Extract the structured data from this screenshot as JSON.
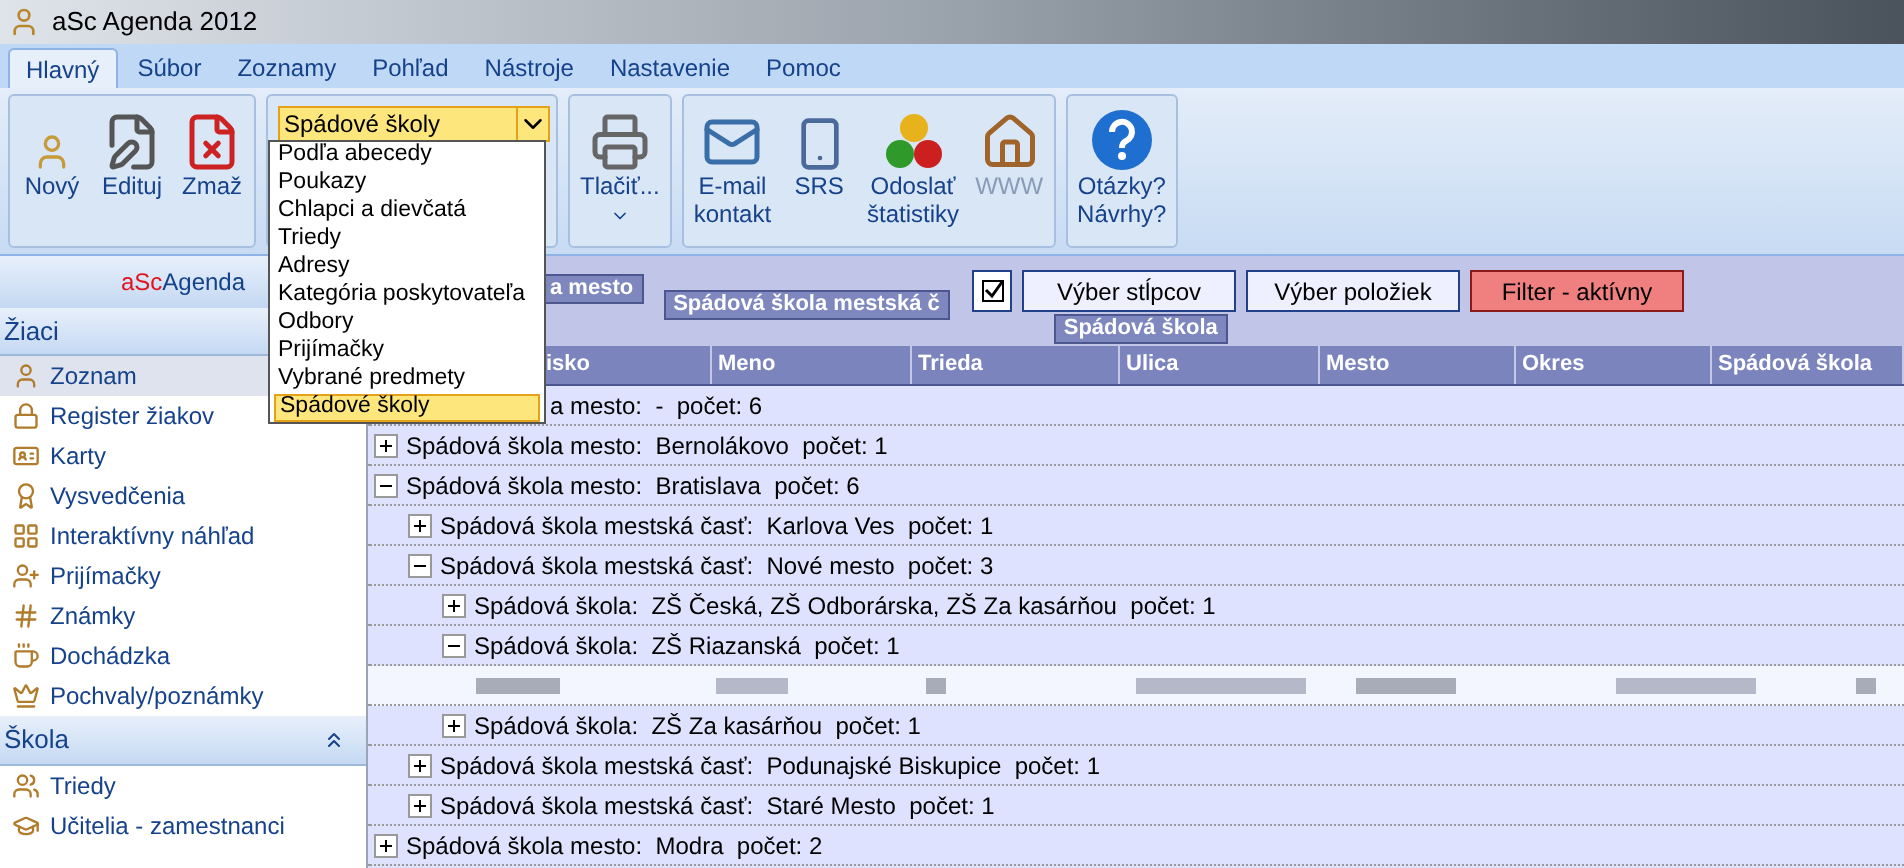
{
  "window": {
    "title": "aSc Agenda 2012"
  },
  "tabs": [
    {
      "label": "Hlavný",
      "selected": true
    },
    {
      "label": "Súbor",
      "selected": false
    },
    {
      "label": "Zoznamy",
      "selected": false
    },
    {
      "label": "Pohľad",
      "selected": false
    },
    {
      "label": "Nástroje",
      "selected": false
    },
    {
      "label": "Nastavenie",
      "selected": false
    },
    {
      "label": "Pomoc",
      "selected": false
    }
  ],
  "ribbon": {
    "groups": [
      {
        "kind": "buttons",
        "buttons": [
          {
            "lines": [
              "Nový"
            ],
            "disabled": false,
            "menu": false
          },
          {
            "lines": [
              "Edituj"
            ],
            "disabled": false,
            "menu": false
          },
          {
            "lines": [
              "Zmaž"
            ],
            "disabled": false,
            "menu": false
          }
        ]
      },
      {
        "kind": "combo",
        "value": "Spádové školy",
        "expanded": true,
        "options": [
          {
            "label": "Podľa abecedy",
            "selected": false
          },
          {
            "label": "Poukazy",
            "selected": false
          },
          {
            "label": "Chlapci a dievčatá",
            "selected": false
          },
          {
            "label": "Triedy",
            "selected": false
          },
          {
            "label": "Adresy",
            "selected": false
          },
          {
            "label": "Kategória poskytovateľa",
            "selected": false
          },
          {
            "label": "Odbory",
            "selected": false
          },
          {
            "label": "Prijímačky",
            "selected": false
          },
          {
            "label": "Vybrané predmety",
            "selected": false
          },
          {
            "label": "Spádové školy",
            "selected": true
          }
        ]
      },
      {
        "kind": "buttons",
        "buttons": [
          {
            "lines": [
              "Tlačiť..."
            ],
            "disabled": false,
            "menu": true
          }
        ]
      },
      {
        "kind": "buttons",
        "buttons": [
          {
            "lines": [
              "E-mail",
              "kontakt"
            ],
            "disabled": false,
            "menu": false
          },
          {
            "lines": [
              "SRS"
            ],
            "disabled": false,
            "menu": false
          },
          {
            "lines": [
              "Odoslať",
              "štatistiky"
            ],
            "disabled": false,
            "menu": false
          },
          {
            "lines": [
              "WWW"
            ],
            "disabled": true,
            "menu": false
          }
        ]
      },
      {
        "kind": "buttons",
        "buttons": [
          {
            "lines": [
              "Otázky?",
              "Návrhy?"
            ],
            "disabled": false,
            "menu": false
          }
        ]
      }
    ]
  },
  "sidebar": {
    "brand_prefix": "aSc",
    "brand_suffix": "Agenda",
    "sections": [
      {
        "title": "Žiaci",
        "collapsible": false,
        "items": [
          {
            "label": "Zoznam",
            "selected": true
          },
          {
            "label": "Register žiakov",
            "selected": false
          },
          {
            "label": "Karty",
            "selected": false
          },
          {
            "label": "Vysvedčenia",
            "selected": false
          },
          {
            "label": "Interaktívny náhľad",
            "selected": false
          },
          {
            "label": "Prijímačky",
            "selected": false
          },
          {
            "label": "Známky",
            "selected": false
          },
          {
            "label": "Dochádzka",
            "selected": false
          },
          {
            "label": "Pochvaly/poznámky",
            "selected": false
          }
        ]
      },
      {
        "title": "Škola",
        "collapsible": true,
        "items": [
          {
            "label": "Triedy",
            "selected": false
          },
          {
            "label": "Učitelia - zamestnanci",
            "selected": false
          }
        ]
      }
    ]
  },
  "group_panel": {
    "groups": [
      "a mesto",
      "Spádová škola mestská č",
      "Spádová škola"
    ],
    "checkbox_checked": true,
    "buttons": [
      {
        "label": "Výber stĺpcov",
        "active": false
      },
      {
        "label": "Výber položiek",
        "active": false
      },
      {
        "label": "Filter - aktívny",
        "active": true
      }
    ]
  },
  "table": {
    "columns": [
      "isko",
      "Meno",
      "Trieda",
      "Ulica",
      "Mesto",
      "Okres",
      "Spádová škola"
    ],
    "covered_row": "a mesto:  -  počet: 6",
    "rows": [
      {
        "kind": "group",
        "label": "Spádová škola mesto:  Bernolákovo  počet: 1",
        "expanded": false
      },
      {
        "kind": "group",
        "label": "Spádová škola mesto:  Bratislava  počet: 6",
        "expanded": true,
        "children": [
          {
            "kind": "group",
            "label": "Spádová škola mestská časť:  Karlova Ves  počet: 1",
            "expanded": false
          },
          {
            "kind": "group",
            "label": "Spádová škola mestská časť:  Nové mesto  počet: 3",
            "expanded": true,
            "children": [
              {
                "kind": "group",
                "label": "Spádová škola:  ZŠ Česká, ZŠ Odborárska, ZŠ Za kasárňou  počet: 1",
                "expanded": false
              },
              {
                "kind": "group",
                "label": "Spádová škola:  ZŠ Riazanská  počet: 1",
                "expanded": true,
                "children": [
                  {
                    "kind": "blurred"
                  }
                ]
              },
              {
                "kind": "group",
                "label": "Spádová škola:  ZŠ Za kasárňou  počet: 1",
                "expanded": false
              }
            ]
          },
          {
            "kind": "group",
            "label": "Spádová škola mestská časť:  Podunajské Biskupice  počet: 1",
            "expanded": false
          },
          {
            "kind": "group",
            "label": "Spádová škola mestská časť:  Staré Mesto  počet: 1",
            "expanded": false
          }
        ]
      },
      {
        "kind": "group",
        "label": "Spádová škola mesto:  Modra  počet: 2",
        "expanded": false
      }
    ]
  }
}
